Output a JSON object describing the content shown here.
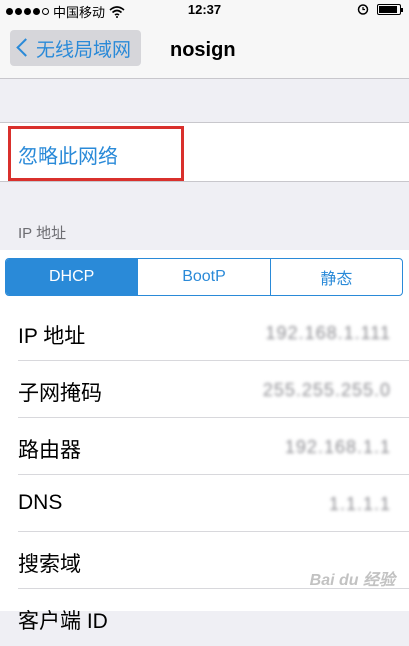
{
  "status_bar": {
    "carrier": "中国移动",
    "time": "12:37",
    "signal_bars_filled": 4,
    "signal_bars_total": 5,
    "battery_level": 0.9
  },
  "nav": {
    "back_label": "无线局域网",
    "title": "nosign"
  },
  "forget_network": {
    "label": "忽略此网络"
  },
  "ip_section": {
    "header": "IP 地址",
    "segments": [
      "DHCP",
      "BootP",
      "静态"
    ],
    "selected_segment": "DHCP"
  },
  "rows": [
    {
      "label": "IP 地址",
      "value": "192.168.1.111"
    },
    {
      "label": "子网掩码",
      "value": "255.255.255.0"
    },
    {
      "label": "路由器",
      "value": "192.168.1.1"
    },
    {
      "label": "DNS",
      "value": "1.1.1.1"
    },
    {
      "label": "搜索域",
      "value": ""
    },
    {
      "label": "客户端 ID",
      "value": ""
    }
  ],
  "watermark": "Bai du 经验",
  "colors": {
    "accent": "#2a8ad8",
    "annotation_box": "#d9302c",
    "background": "#efeff4"
  }
}
